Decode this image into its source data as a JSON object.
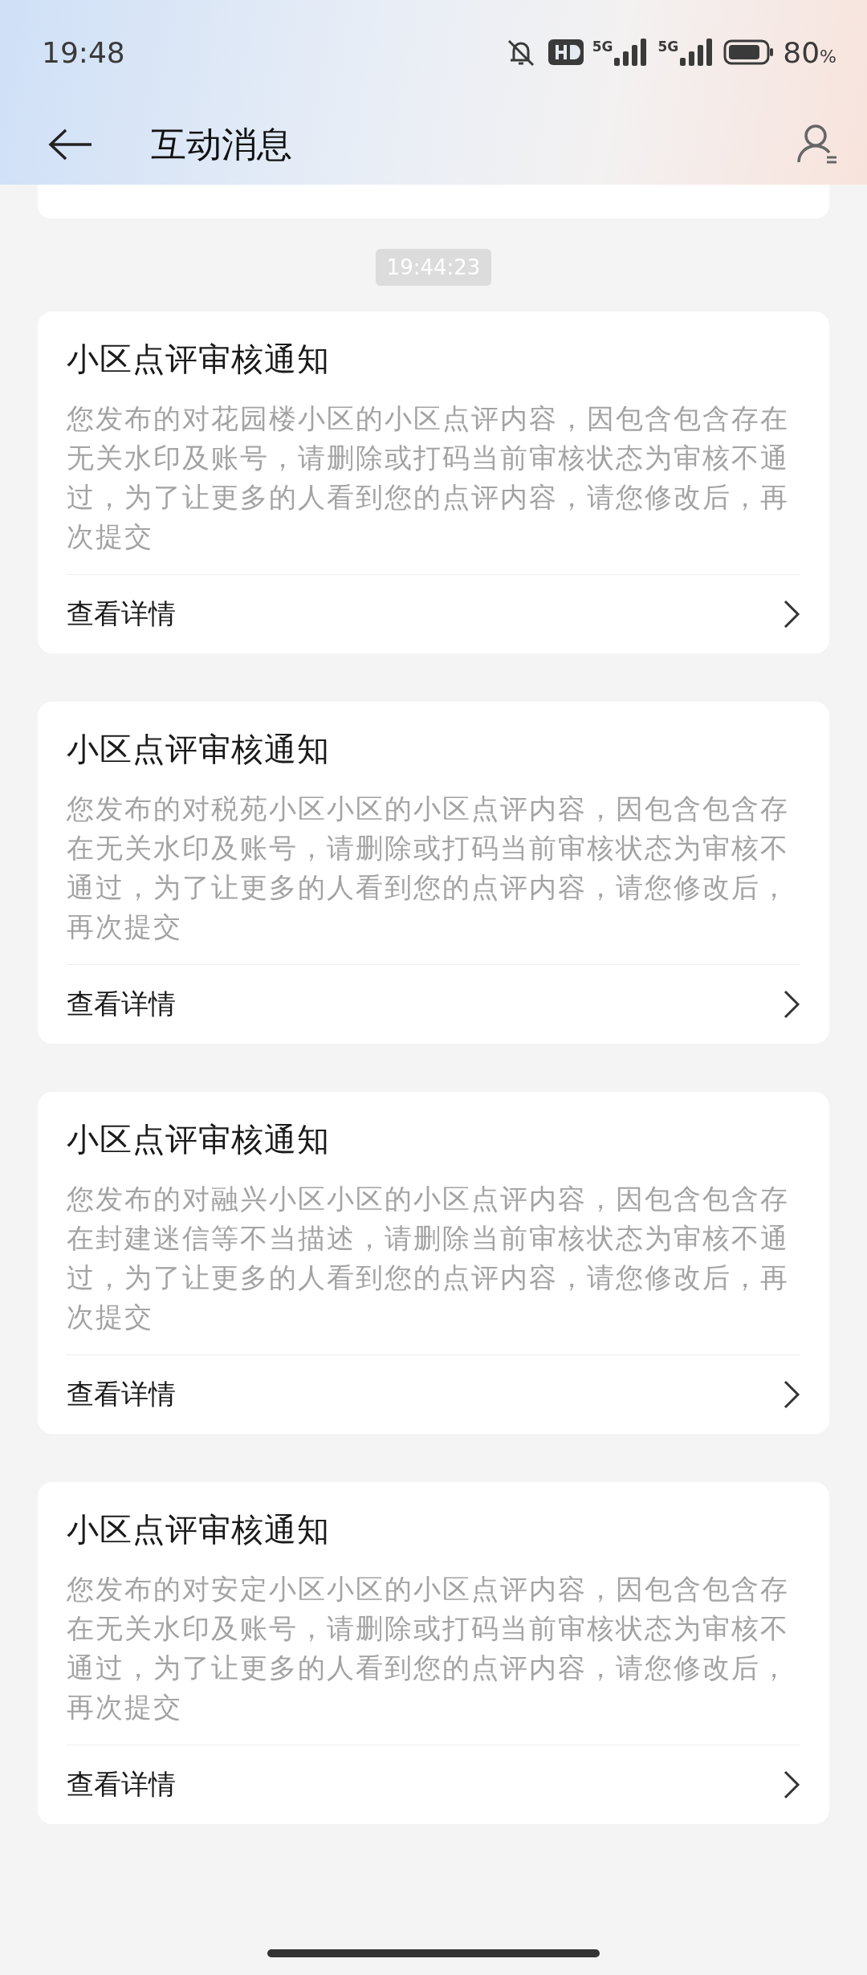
{
  "status_bar": {
    "time": "19:48",
    "network_1": "5G",
    "network_2": "5G",
    "battery_level": "80",
    "battery_unit": "%"
  },
  "header": {
    "title": "互动消息"
  },
  "timestamp": "19:44:23",
  "messages": [
    {
      "title": "小区点评审核通知",
      "body": "您发布的对花园楼小区的小区点评内容，因包含包含存在无关水印及账号，请删除或打码当前审核状态为审核不通过，为了让更多的人看到您的点评内容，请您修改后，再次提交",
      "link": "查看详情"
    },
    {
      "title": "小区点评审核通知",
      "body": "您发布的对税苑小区小区的小区点评内容，因包含包含存在无关水印及账号，请删除或打码当前审核状态为审核不通过，为了让更多的人看到您的点评内容，请您修改后，再次提交",
      "link": "查看详情"
    },
    {
      "title": "小区点评审核通知",
      "body": "您发布的对融兴小区小区的小区点评内容，因包含包含存在封建迷信等不当描述，请删除当前审核状态为审核不通过，为了让更多的人看到您的点评内容，请您修改后，再次提交",
      "link": "查看详情"
    },
    {
      "title": "小区点评审核通知",
      "body": "您发布的对安定小区小区的小区点评内容，因包含包含存在无关水印及账号，请删除或打码当前审核状态为审核不通过，为了让更多的人看到您的点评内容，请您修改后，再次提交",
      "link": "查看详情"
    }
  ]
}
